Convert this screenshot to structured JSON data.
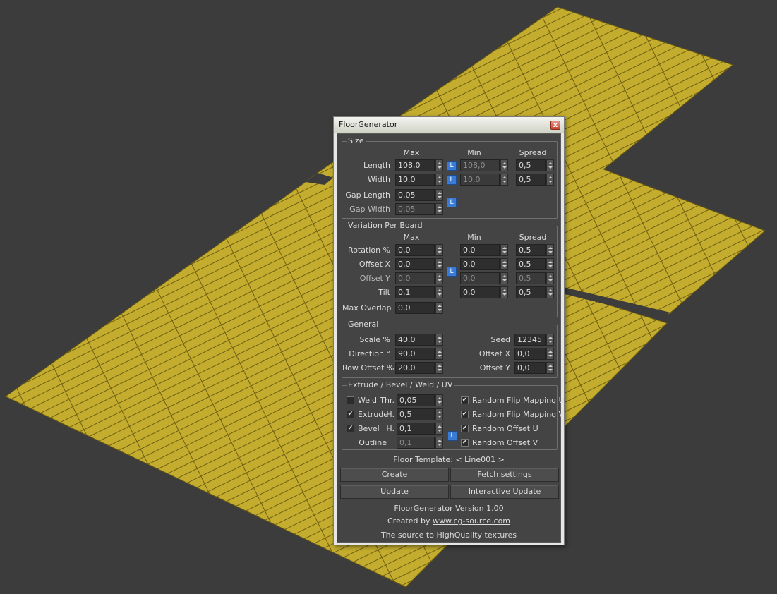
{
  "window": {
    "title": "FloorGenerator",
    "close_label": "x"
  },
  "columns": {
    "max": "Max",
    "min": "Min",
    "spread": "Spread"
  },
  "lock_label": "L",
  "size": {
    "title": "Size",
    "length": {
      "label": "Length",
      "max": "108,0",
      "min": "108,0",
      "spread": "0,5"
    },
    "width": {
      "label": "Width",
      "max": "10,0",
      "min": "10,0",
      "spread": "0,5"
    },
    "gap_length": {
      "label": "Gap Length",
      "value": "0,05"
    },
    "gap_width": {
      "label": "Gap Width",
      "value": "0,05"
    }
  },
  "variation": {
    "title": "Variation Per Board",
    "rotation": {
      "label": "Rotation %",
      "max": "0,0",
      "min": "0,0",
      "spread": "0,5"
    },
    "offset_x": {
      "label": "Offset X",
      "max": "0,0",
      "min": "0,0",
      "spread": "0,5"
    },
    "offset_y": {
      "label": "Offset Y",
      "max": "0,0",
      "min": "0,0",
      "spread": "0,5"
    },
    "tilt": {
      "label": "Tilt",
      "max": "0,1",
      "min": "0,0",
      "spread": "0,5"
    },
    "max_overlap": {
      "label": "Max Overlap",
      "value": "0,0"
    }
  },
  "general": {
    "title": "General",
    "scale": {
      "label": "Scale %",
      "value": "40,0"
    },
    "direction": {
      "label": "Direction °",
      "value": "90,0"
    },
    "row_offset": {
      "label": "Row Offset %",
      "value": "20,0"
    },
    "seed": {
      "label": "Seed",
      "value": "12345"
    },
    "offset_x": {
      "label": "Offset X",
      "value": "0,0"
    },
    "offset_y": {
      "label": "Offset Y",
      "value": "0,0"
    }
  },
  "extrude": {
    "title": "Extrude / Bevel / Weld / UV",
    "weld": {
      "label": "Weld",
      "checked": false,
      "sub": "Thr.",
      "value": "0,05"
    },
    "extrude": {
      "label": "Extrude",
      "checked": true,
      "sub": "H.",
      "value": "0,5"
    },
    "bevel": {
      "label": "Bevel",
      "checked": true,
      "sub": "H.",
      "value": "0,1"
    },
    "outline": {
      "label": "Outline",
      "value": "0,1"
    },
    "flip_u": {
      "label": "Random Flip Mapping U",
      "checked": true
    },
    "flip_v": {
      "label": "Random Flip Mapping V",
      "checked": true
    },
    "offset_u": {
      "label": "Random Offset U",
      "checked": true
    },
    "offset_v": {
      "label": "Random Offset V",
      "checked": true
    }
  },
  "template": {
    "label": "Floor Template: < Line001 >"
  },
  "buttons": {
    "create": "Create",
    "fetch": "Fetch settings",
    "update": "Update",
    "interactive": "Interactive Update"
  },
  "footer": {
    "version": "FloorGenerator Version 1.00",
    "created_by": "Created by ",
    "link": "www.cg-source.com",
    "tagline": "The source to HighQuality textures"
  },
  "colors": {
    "viewport": "#3c3c3c",
    "floor": "#c4ad2e",
    "floor_lines": "#6d5e12",
    "panel": "#444444",
    "lock": "#3a7bd5"
  }
}
